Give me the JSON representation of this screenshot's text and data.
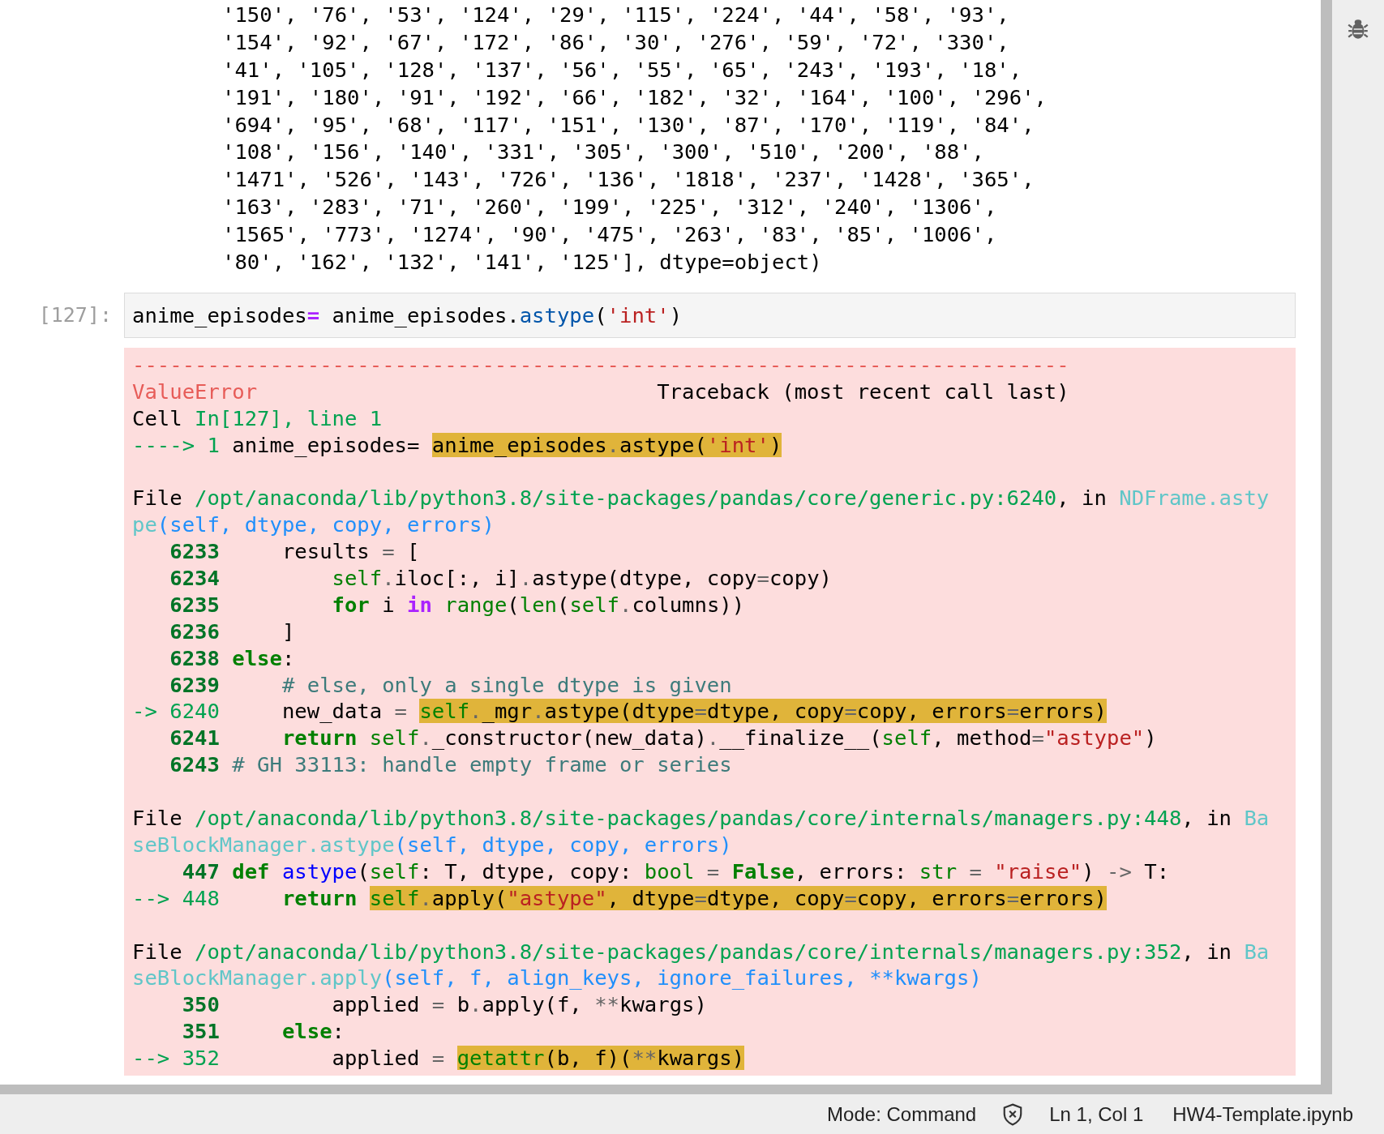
{
  "output_lines": [
    "'150', '76', '53', '124', '29', '115', '224', '44', '58', '93',",
    "'154', '92', '67', '172', '86', '30', '276', '59', '72', '330',",
    "'41', '105', '128', '137', '56', '55', '65', '243', '193', '18',",
    "'191', '180', '91', '192', '66', '182', '32', '164', '100', '296',",
    "'694', '95', '68', '117', '151', '130', '87', '170', '119', '84',",
    "'108', '156', '140', '331', '305', '300', '510', '200', '88',",
    "'1471', '526', '143', '726', '136', '1818', '237', '1428', '365',",
    "'163', '283', '71', '260', '199', '225', '312', '240', '1306',",
    "'1565', '773', '1274', '90', '475', '263', '83', '85', '1006',",
    "'80', '162', '132', '141', '125'], dtype=object)"
  ],
  "input_cell": {
    "prompt": "[127]:",
    "tokens": [
      {
        "kind": "plain",
        "text": "anime_episodes"
      },
      {
        "kind": "operator",
        "text": "="
      },
      {
        "kind": "plain",
        "text": " anime_episodes."
      },
      {
        "kind": "property",
        "text": "astype"
      },
      {
        "kind": "plain",
        "text": "("
      },
      {
        "kind": "string",
        "text": "'int'"
      },
      {
        "kind": "plain",
        "text": ")"
      }
    ]
  },
  "traceback": [
    [
      [
        {
          "kind": "error",
          "text": "---------------------------------------------------------------------------"
        }
      ],
      [
        {
          "kind": "error",
          "text": "ValueError"
        },
        {
          "kind": "plain",
          "text": "                                Traceback (most recent call last)"
        }
      ],
      [
        {
          "kind": "plain",
          "text": "Cell "
        },
        {
          "kind": "green",
          "text": "In[127], line 1"
        }
      ],
      [
        {
          "kind": "green",
          "text": "----> 1 "
        },
        {
          "kind": "plain",
          "text": "anime_episodes= "
        },
        {
          "kind": "highlight",
          "tokens": [
            {
              "kind": "plain",
              "text": "anime_episodes"
            },
            {
              "kind": "op",
              "text": "."
            },
            {
              "kind": "plain",
              "text": "astype("
            },
            {
              "kind": "string",
              "text": "'int'"
            },
            {
              "kind": "plain",
              "text": ")"
            }
          ]
        }
      ]
    ],
    [
      [
        {
          "kind": "plain",
          "text": "File "
        },
        {
          "kind": "green",
          "text": "/opt/anaconda/lib/python3.8/site-packages/pandas/core/generic.py:6240"
        },
        {
          "kind": "plain",
          "text": ", in "
        },
        {
          "kind": "cyan",
          "text": "NDFrame.asty"
        }
      ],
      [
        {
          "kind": "cyan",
          "text": "pe"
        },
        {
          "kind": "blue",
          "text": "(self, dtype, copy, errors)"
        }
      ],
      [
        {
          "kind": "lineno",
          "text": "   6233"
        },
        {
          "kind": "plain",
          "text": "     results "
        },
        {
          "kind": "op",
          "text": "="
        },
        {
          "kind": "plain",
          "text": " ["
        }
      ],
      [
        {
          "kind": "lineno",
          "text": "   6234         "
        },
        {
          "kind": "builtin",
          "text": "self"
        },
        {
          "kind": "op",
          "text": "."
        },
        {
          "kind": "plain",
          "text": "iloc[:, i]"
        },
        {
          "kind": "op",
          "text": "."
        },
        {
          "kind": "plain",
          "text": "astype(dtype, copy"
        },
        {
          "kind": "op",
          "text": "="
        },
        {
          "kind": "plain",
          "text": "copy)"
        }
      ],
      [
        {
          "kind": "lineno",
          "text": "   6235         "
        },
        {
          "kind": "keyword",
          "text": "for"
        },
        {
          "kind": "plain",
          "text": " i "
        },
        {
          "kind": "keyword_op",
          "text": "in "
        },
        {
          "kind": "builtin",
          "text": "range"
        },
        {
          "kind": "plain",
          "text": "("
        },
        {
          "kind": "builtin",
          "text": "len"
        },
        {
          "kind": "plain",
          "text": "("
        },
        {
          "kind": "builtin",
          "text": "self"
        },
        {
          "kind": "op",
          "text": "."
        },
        {
          "kind": "plain",
          "text": "columns))"
        }
      ],
      [
        {
          "kind": "lineno",
          "text": "   6236"
        },
        {
          "kind": "plain",
          "text": "     ]"
        }
      ],
      [
        {
          "kind": "lineno",
          "text": "   6238 "
        },
        {
          "kind": "keyword",
          "text": "else"
        },
        {
          "kind": "plain",
          "text": ":"
        }
      ],
      [
        {
          "kind": "lineno",
          "text": "   6239     "
        },
        {
          "kind": "comment",
          "text": "# else, only a single dtype is given"
        }
      ],
      [
        {
          "kind": "green",
          "text": "-> 6240"
        },
        {
          "kind": "plain",
          "text": "     new_data "
        },
        {
          "kind": "op",
          "text": "= "
        },
        {
          "kind": "highlight",
          "tokens": [
            {
              "kind": "builtin",
              "text": "self"
            },
            {
              "kind": "op",
              "text": "."
            },
            {
              "kind": "plain",
              "text": "_mgr"
            },
            {
              "kind": "op",
              "text": "."
            },
            {
              "kind": "plain",
              "text": "astype(dtype"
            },
            {
              "kind": "op",
              "text": "="
            },
            {
              "kind": "plain",
              "text": "dtype, copy"
            },
            {
              "kind": "op",
              "text": "="
            },
            {
              "kind": "plain",
              "text": "copy, errors"
            },
            {
              "kind": "op",
              "text": "="
            },
            {
              "kind": "plain",
              "text": "errors)"
            }
          ]
        }
      ],
      [
        {
          "kind": "lineno",
          "text": "   6241     "
        },
        {
          "kind": "keyword",
          "text": "return "
        },
        {
          "kind": "builtin",
          "text": "self"
        },
        {
          "kind": "op",
          "text": "."
        },
        {
          "kind": "plain",
          "text": "_constructor(new_data)"
        },
        {
          "kind": "op",
          "text": "."
        },
        {
          "kind": "plain",
          "text": "__finalize__("
        },
        {
          "kind": "builtin",
          "text": "self"
        },
        {
          "kind": "plain",
          "text": ", method"
        },
        {
          "kind": "op",
          "text": "="
        },
        {
          "kind": "string",
          "text": "\"astype\""
        },
        {
          "kind": "plain",
          "text": ")"
        }
      ],
      [
        {
          "kind": "lineno",
          "text": "   6243 "
        },
        {
          "kind": "comment",
          "text": "# GH 33113: handle empty frame or series"
        }
      ]
    ],
    [
      [
        {
          "kind": "plain",
          "text": "File "
        },
        {
          "kind": "green",
          "text": "/opt/anaconda/lib/python3.8/site-packages/pandas/core/internals/managers.py:448"
        },
        {
          "kind": "plain",
          "text": ", in "
        },
        {
          "kind": "cyan",
          "text": "Ba"
        }
      ],
      [
        {
          "kind": "cyan",
          "text": "seBlockManager.astype"
        },
        {
          "kind": "blue",
          "text": "(self, dtype, copy, errors)"
        }
      ],
      [
        {
          "kind": "lineno",
          "text": "    447 "
        },
        {
          "kind": "keyword",
          "text": "def "
        },
        {
          "kind": "funcname",
          "text": "astype"
        },
        {
          "kind": "plain",
          "text": "("
        },
        {
          "kind": "builtin",
          "text": "self"
        },
        {
          "kind": "plain",
          "text": ": T, dtype, copy: "
        },
        {
          "kind": "builtin",
          "text": "bool "
        },
        {
          "kind": "op",
          "text": "= "
        },
        {
          "kind": "keyword",
          "text": "False"
        },
        {
          "kind": "plain",
          "text": ", errors: "
        },
        {
          "kind": "builtin",
          "text": "str "
        },
        {
          "kind": "op",
          "text": "= "
        },
        {
          "kind": "string",
          "text": "\"raise\""
        },
        {
          "kind": "plain",
          "text": ") "
        },
        {
          "kind": "op",
          "text": "->"
        },
        {
          "kind": "plain",
          "text": " T:"
        }
      ],
      [
        {
          "kind": "green",
          "text": "--> 448     "
        },
        {
          "kind": "keyword",
          "text": "return "
        },
        {
          "kind": "highlight",
          "tokens": [
            {
              "kind": "builtin",
              "text": "self"
            },
            {
              "kind": "op",
              "text": "."
            },
            {
              "kind": "plain",
              "text": "apply("
            },
            {
              "kind": "string",
              "text": "\"astype\""
            },
            {
              "kind": "plain",
              "text": ", dtype"
            },
            {
              "kind": "op",
              "text": "="
            },
            {
              "kind": "plain",
              "text": "dtype, copy"
            },
            {
              "kind": "op",
              "text": "="
            },
            {
              "kind": "plain",
              "text": "copy, errors"
            },
            {
              "kind": "op",
              "text": "="
            },
            {
              "kind": "plain",
              "text": "errors)"
            }
          ]
        }
      ]
    ],
    [
      [
        {
          "kind": "plain",
          "text": "File "
        },
        {
          "kind": "green",
          "text": "/opt/anaconda/lib/python3.8/site-packages/pandas/core/internals/managers.py:352"
        },
        {
          "kind": "plain",
          "text": ", in "
        },
        {
          "kind": "cyan",
          "text": "Ba"
        }
      ],
      [
        {
          "kind": "cyan",
          "text": "seBlockManager.apply"
        },
        {
          "kind": "blue",
          "text": "(self, f, align_keys, ignore_failures, **kwargs)"
        }
      ],
      [
        {
          "kind": "lineno",
          "text": "    350"
        },
        {
          "kind": "plain",
          "text": "         applied "
        },
        {
          "kind": "op",
          "text": "="
        },
        {
          "kind": "plain",
          "text": " b"
        },
        {
          "kind": "op",
          "text": "."
        },
        {
          "kind": "plain",
          "text": "apply(f, "
        },
        {
          "kind": "op",
          "text": "**"
        },
        {
          "kind": "plain",
          "text": "kwargs)"
        }
      ],
      [
        {
          "kind": "lineno",
          "text": "    351     "
        },
        {
          "kind": "keyword",
          "text": "else"
        },
        {
          "kind": "plain",
          "text": ":"
        }
      ],
      [
        {
          "kind": "green",
          "text": "--> 352"
        },
        {
          "kind": "plain",
          "text": "         applied "
        },
        {
          "kind": "op",
          "text": "= "
        },
        {
          "kind": "highlight",
          "tokens": [
            {
              "kind": "builtin",
              "text": "getattr"
            },
            {
              "kind": "plain",
              "text": "(b, f)("
            },
            {
              "kind": "op",
              "text": "**"
            },
            {
              "kind": "plain",
              "text": "kwargs)"
            }
          ]
        }
      ]
    ]
  ],
  "status_bar": {
    "mode": "Mode: Command",
    "position": "Ln 1, Col 1",
    "file": "HW4-Template.ipynb"
  }
}
